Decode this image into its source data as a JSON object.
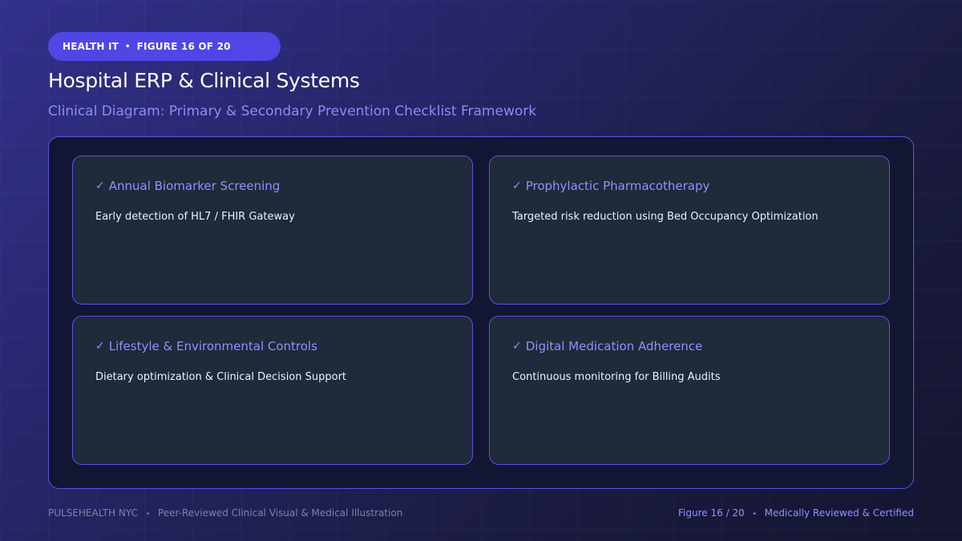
{
  "header": {
    "category": "HEALTH IT",
    "figure_label": "FIGURE 16 OF 20",
    "title": "Hospital ERP & Clinical Systems",
    "subtitle": "Clinical Diagram: Primary & Secondary Prevention Checklist Framework"
  },
  "cards": [
    {
      "title": "Annual Biomarker Screening",
      "description": "Early detection of HL7 / FHIR Gateway",
      "icon": "check-icon"
    },
    {
      "title": "Prophylactic Pharmacotherapy",
      "description": "Targeted risk reduction using Bed Occupancy Optimization",
      "icon": "check-icon"
    },
    {
      "title": "Lifestyle & Environmental Controls",
      "description": "Dietary optimization & Clinical Decision Support",
      "icon": "check-icon"
    },
    {
      "title": "Digital Medication Adherence",
      "description": "Continuous monitoring for Billing Audits",
      "icon": "check-icon"
    }
  ],
  "footer": {
    "brand": "PULSEHEALTH NYC",
    "tagline": "Peer-Reviewed Clinical Visual & Medical Illustration",
    "figure": "Figure 16 / 20",
    "certification": "Medically Reviewed & Certified"
  },
  "colors": {
    "accent": "#5046e5",
    "accent_text": "#8d93fb",
    "card_background": "#1f2a3a",
    "card_border": "#5a52e6"
  }
}
